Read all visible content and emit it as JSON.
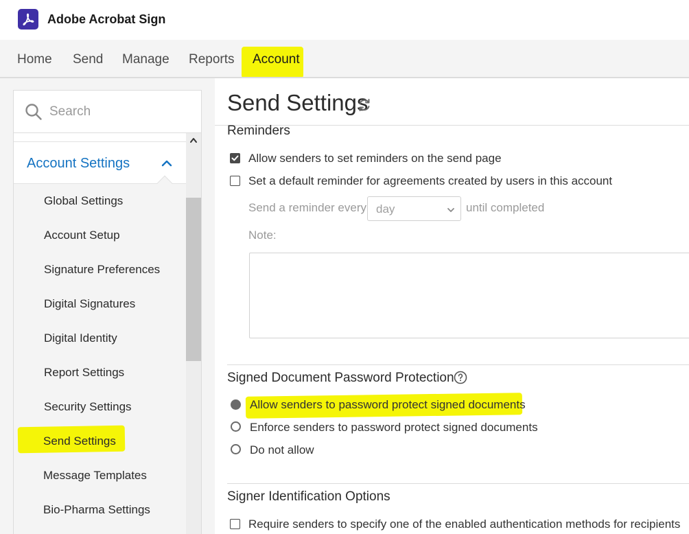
{
  "app": {
    "title": "Adobe Acrobat Sign"
  },
  "nav": {
    "tabs": [
      {
        "label": "Home"
      },
      {
        "label": "Send"
      },
      {
        "label": "Manage"
      },
      {
        "label": "Reports"
      },
      {
        "label": "Account",
        "active": true
      }
    ]
  },
  "sidebar": {
    "search": {
      "placeholder": "Search"
    },
    "section": {
      "title": "Account Settings",
      "expanded": true
    },
    "items": [
      {
        "label": "Global Settings"
      },
      {
        "label": "Account Setup"
      },
      {
        "label": "Signature Preferences"
      },
      {
        "label": "Digital Signatures"
      },
      {
        "label": "Digital Identity"
      },
      {
        "label": "Report Settings"
      },
      {
        "label": "Security Settings"
      },
      {
        "label": "Send Settings",
        "active": true
      },
      {
        "label": "Message Templates"
      },
      {
        "label": "Bio-Pharma Settings"
      }
    ]
  },
  "main": {
    "title": "Send Settings",
    "reminders": {
      "heading": "Reminders",
      "options": [
        {
          "label": "Allow senders to set reminders on the send page",
          "checked": true
        },
        {
          "label": "Set a default reminder for agreements created by users in this account",
          "checked": false
        }
      ],
      "interval": {
        "prefix": "Send a reminder every",
        "value": "day",
        "suffix": "until completed"
      },
      "note_label": "Note:"
    },
    "password_protection": {
      "heading": "Signed Document Password Protection",
      "options": [
        {
          "label": "Allow senders to password protect signed documents",
          "selected": true
        },
        {
          "label": "Enforce senders to password protect signed documents",
          "selected": false
        },
        {
          "label": "Do not allow",
          "selected": false
        }
      ]
    },
    "signer_identification": {
      "heading": "Signer Identification Options",
      "options": [
        {
          "label": "Require senders to specify one of the enabled authentication methods for recipients",
          "checked": false
        }
      ]
    }
  },
  "colors": {
    "highlight": "#f5f507",
    "link_blue": "#1473c2",
    "logo_bg": "#3f2fa6"
  }
}
